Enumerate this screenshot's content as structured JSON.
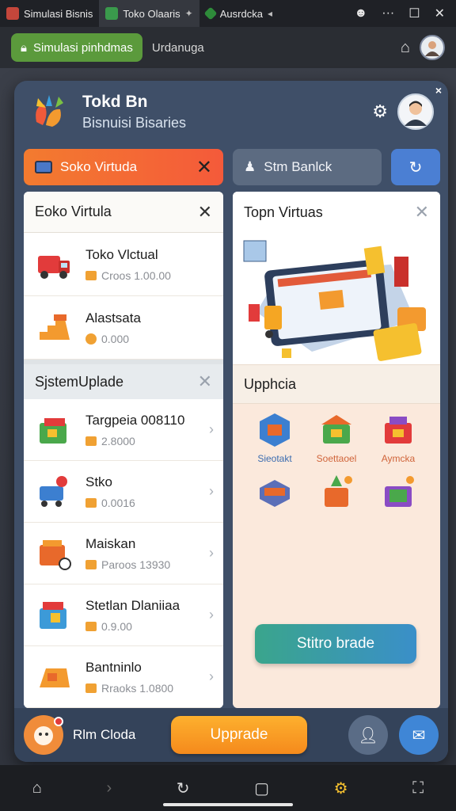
{
  "browser": {
    "tabs": [
      {
        "label": "Simulasi Bisnis",
        "color": "#c4463b"
      },
      {
        "label": "Toko Olaaris",
        "color": "#3a9a4c"
      },
      {
        "label": "Ausrdcka",
        "color": "#2e8b3a"
      }
    ],
    "site_chip": "Simulasi pinhdmas",
    "address": "Urdanuga"
  },
  "modal": {
    "close_glyph": "×",
    "title": "Tokd Bn",
    "subtitle": "Bisnuisi Bisaries"
  },
  "segments": {
    "active": "Soko Virtuda",
    "secondary": "Stm Banlck"
  },
  "left_panel": {
    "title": "Eoko Virtula",
    "items": [
      {
        "name": "Toko Vlctual",
        "meta": "Croos 1.00.00"
      },
      {
        "name": "Alastsata",
        "meta": "0.000"
      }
    ],
    "system_title": "SjstemUplade",
    "system_items": [
      {
        "name": "Targpeia 008110",
        "meta": "2.8000"
      },
      {
        "name": "Stko",
        "meta": "0.0016"
      },
      {
        "name": "Maiskan",
        "meta": "Paroos 13930"
      },
      {
        "name": "Stetlan Dlaniiaa",
        "meta": "0.9.00"
      },
      {
        "name": "Bantninlo",
        "meta": "Rraoks 1.0800"
      }
    ]
  },
  "right_panel": {
    "title": "Topn Virtuas",
    "upgrade_title": "Upphcia",
    "upgrades": [
      {
        "label": "Sieotakt"
      },
      {
        "label": "Soettaoel"
      },
      {
        "label": "Aymcka"
      },
      {
        "label": ""
      },
      {
        "label": ""
      },
      {
        "label": ""
      }
    ],
    "primary_button": "Stitro brade"
  },
  "footer": {
    "user_name": "Rlm Cloda",
    "upgrade_button": "Upprade"
  },
  "colors": {
    "modal_bg": "#3f4f68",
    "active_segment": "#f37b2f",
    "accent_blue": "#4b7fd3",
    "upgrade_orange": "#f58a1c"
  }
}
